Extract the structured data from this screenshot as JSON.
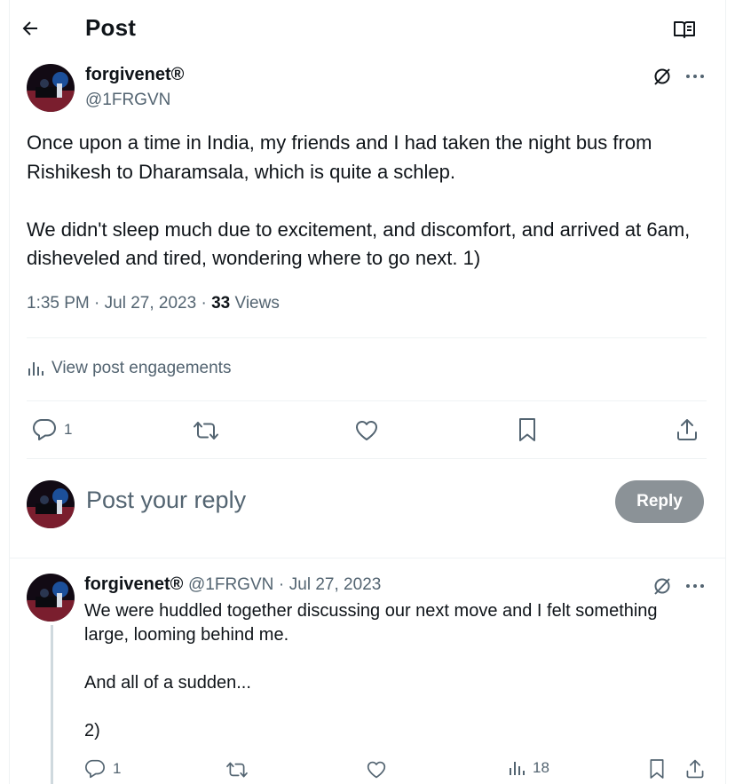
{
  "header": {
    "title": "Post",
    "back_icon": "arrow-left-icon",
    "reader_icon": "book-open-icon"
  },
  "post": {
    "author_name": "forgivenet®",
    "author_handle": "@1FRGVN",
    "text": "Once upon a time in India, my friends and I had taken the night bus from Rishikesh to Dharamsala, which is quite a schlep.\n\nWe didn't sleep much due to excitement, and discomfort, and arrived at 6am, disheveled and tired, wondering where to go next. 1)",
    "time": "1:35 PM",
    "date": "Jul 27, 2023",
    "views_count": "33",
    "views_label": "Views",
    "engagements_label": "View post engagements",
    "reply_count": "1"
  },
  "composer": {
    "placeholder": "Post your reply",
    "button_label": "Reply"
  },
  "reply": {
    "author_name": "forgivenet®",
    "author_handle": "@1FRGVN",
    "date": "Jul 27, 2023",
    "text": "We were huddled together discussing our next move and I felt something large, looming behind me.\n\nAnd all of a sudden...\n\n2)",
    "reply_count": "1",
    "views_count": "18"
  },
  "colors": {
    "accent_grey": "#8b9297",
    "muted": "#536471",
    "text": "#0f1419",
    "divider": "#eff3f4"
  }
}
